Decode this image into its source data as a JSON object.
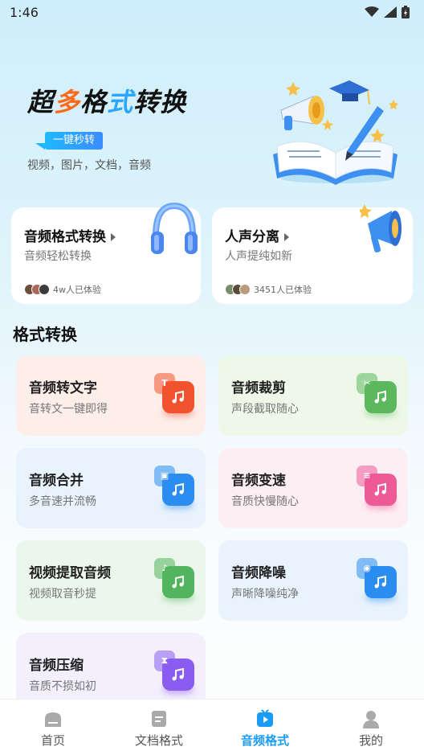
{
  "status": {
    "time": "1:46"
  },
  "hero": {
    "title_parts": [
      "超",
      "多",
      "格",
      "式",
      "转换"
    ],
    "badge": "一键秒转",
    "subtitle": "视频，图片，文档，音频"
  },
  "features": [
    {
      "title": "音频格式转换",
      "subtitle": "音频轻松转换",
      "users": "4w人已体验",
      "icon": "headphones-icon"
    },
    {
      "title": "人声分离",
      "subtitle": "人声提纯如新",
      "users": "3451人已体验",
      "icon": "megaphone-icon"
    }
  ],
  "section": {
    "title": "格式转换"
  },
  "tools": [
    {
      "title": "音频转文字",
      "subtitle": "音转文一键即得",
      "bg": "#fdeeea",
      "color": "#f2522e",
      "glyph": "T",
      "icon": "audio-to-text-icon"
    },
    {
      "title": "音频裁剪",
      "subtitle": "声段截取随心",
      "bg": "#eef8e8",
      "color": "#5cb85c",
      "glyph": "✂",
      "icon": "audio-cut-icon"
    },
    {
      "title": "音频合并",
      "subtitle": "多音速并流畅",
      "bg": "#e9f3fd",
      "color": "#2b8df0",
      "glyph": "▣",
      "icon": "audio-merge-icon"
    },
    {
      "title": "音频变速",
      "subtitle": "音质快慢随心",
      "bg": "#fdeef3",
      "color": "#ee5a96",
      "glyph": "≡",
      "icon": "audio-speed-icon"
    },
    {
      "title": "视频提取音频",
      "subtitle": "视频取音秒提",
      "bg": "#ebf7ec",
      "color": "#52b45c",
      "glyph": "♪",
      "icon": "video-extract-audio-icon"
    },
    {
      "title": "音频降噪",
      "subtitle": "声晰降噪纯净",
      "bg": "#e9f3fd",
      "color": "#2b8df0",
      "glyph": "◉",
      "icon": "audio-denoise-icon"
    },
    {
      "title": "音频压缩",
      "subtitle": "音质不损如初",
      "bg": "#f3effd",
      "color": "#8a5cf0",
      "glyph": "⧗",
      "icon": "audio-compress-icon"
    }
  ],
  "nav": [
    {
      "label": "首页",
      "icon": "home-icon",
      "active": false
    },
    {
      "label": "文档格式",
      "icon": "document-icon",
      "active": false
    },
    {
      "label": "音频格式",
      "icon": "video-play-icon",
      "active": true
    },
    {
      "label": "我的",
      "icon": "profile-icon",
      "active": false
    }
  ],
  "colors": {
    "accent": "#1a9cf5"
  }
}
